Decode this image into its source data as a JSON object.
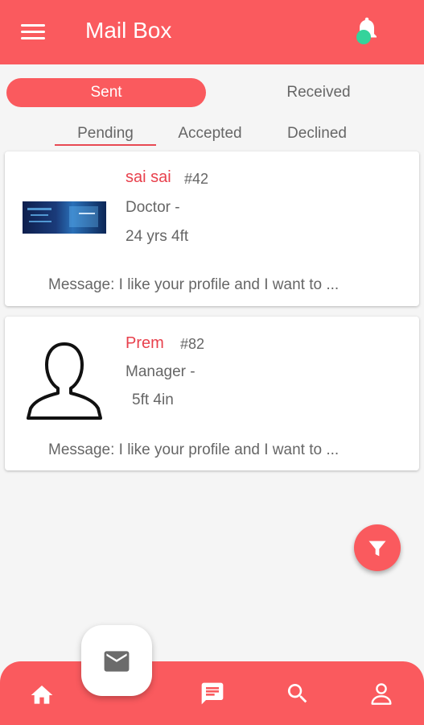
{
  "appbar": {
    "title": "Mail Box"
  },
  "tabs": {
    "sent": "Sent",
    "received": "Received"
  },
  "subtabs": {
    "pending": "Pending",
    "accepted": "Accepted",
    "declined": "Declined"
  },
  "cards": [
    {
      "name": "sai sai",
      "id": "#42",
      "job": "Doctor -",
      "stats": "24 yrs  4ft",
      "message": "Message: I like your profile and I want to ..."
    },
    {
      "name": "Prem",
      "id": "#82",
      "job": "Manager -",
      "stats": "5ft 4in",
      "message": "Message: I like your profile and I want to ..."
    }
  ],
  "colors": {
    "primary": "#fa5a5e",
    "name": "#e8414d",
    "notification_dot": "#35d39b",
    "text_muted": "#666666"
  },
  "icons": {
    "menu": "menu-icon",
    "bell": "bell-icon",
    "filter": "filter-icon",
    "mail": "mail-icon",
    "home": "home-icon",
    "chat": "chat-icon",
    "search": "search-icon",
    "profile": "profile-icon"
  }
}
